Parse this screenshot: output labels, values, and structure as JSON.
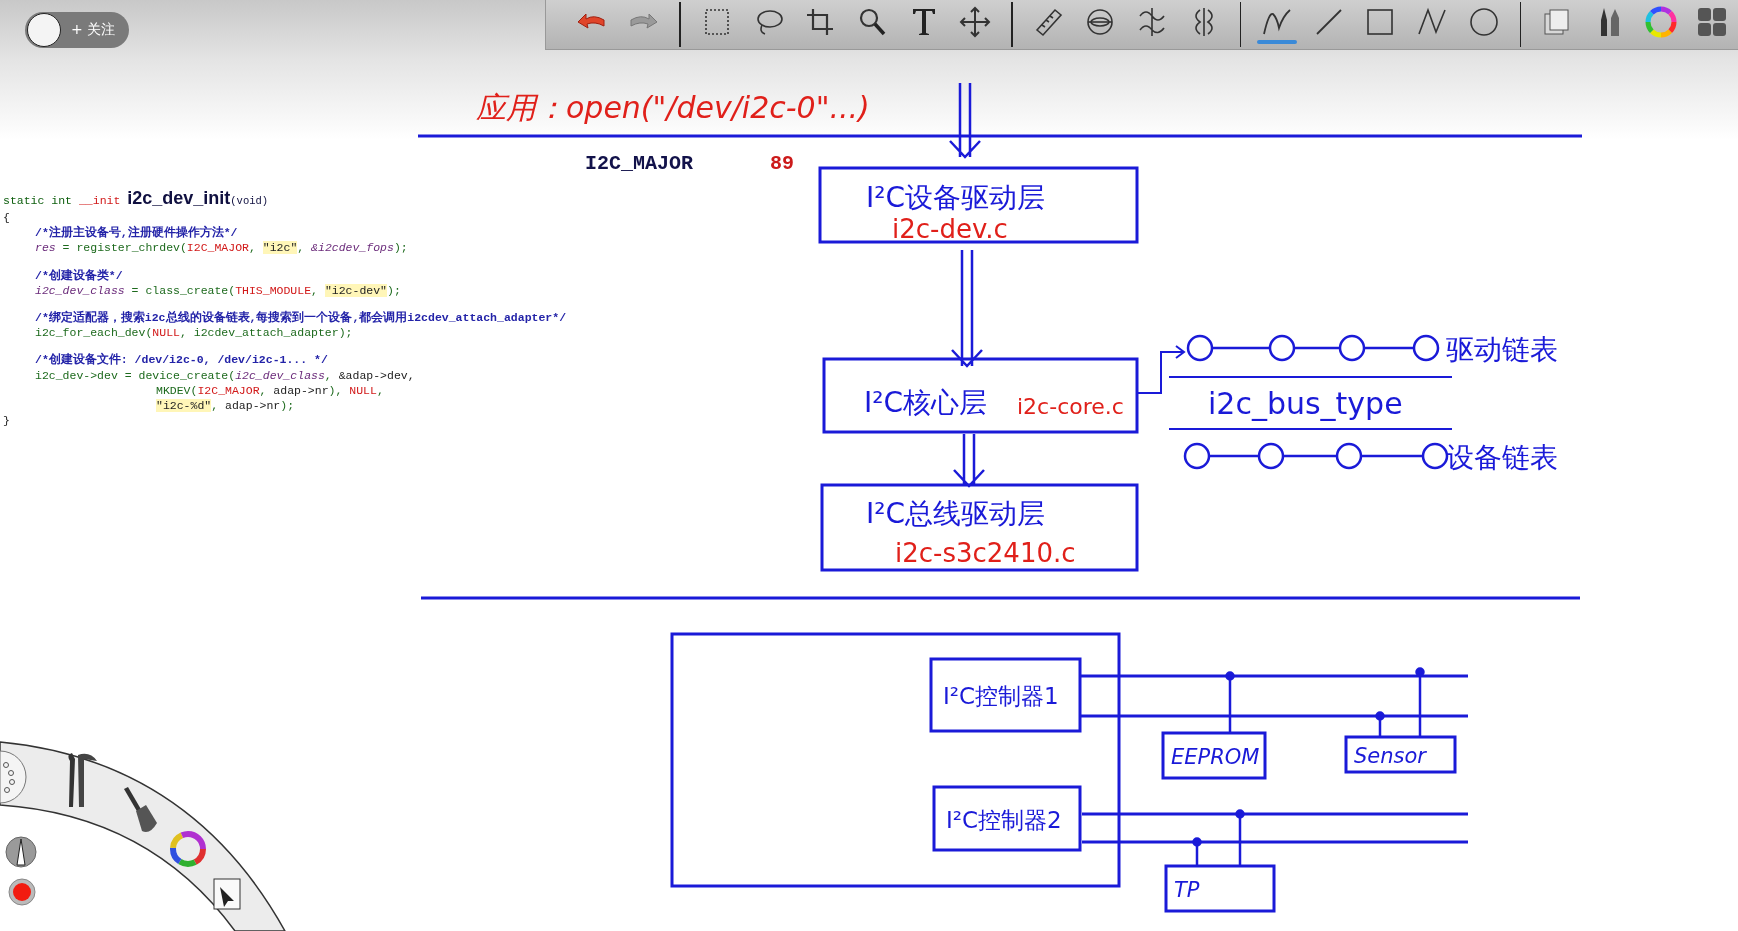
{
  "follow_button": {
    "label": "+ 关注"
  },
  "toolbar": {
    "groups": [
      {
        "tools": [
          {
            "kind": "undo",
            "selected": false
          },
          {
            "kind": "redo",
            "selected": false
          }
        ]
      },
      {
        "tools": [
          {
            "kind": "select",
            "selected": false
          },
          {
            "kind": "lasso",
            "selected": false
          },
          {
            "kind": "crop",
            "selected": false
          },
          {
            "kind": "zoom",
            "selected": false
          },
          {
            "kind": "text",
            "selected": false
          },
          {
            "kind": "move",
            "selected": false
          }
        ]
      },
      {
        "tools": [
          {
            "kind": "ruler",
            "selected": false
          },
          {
            "kind": "ellipse-guide",
            "selected": false
          },
          {
            "kind": "symmetry",
            "selected": false
          },
          {
            "kind": "radial-symmetry",
            "selected": false
          }
        ]
      },
      {
        "tools": [
          {
            "kind": "curve",
            "selected": true
          },
          {
            "kind": "line",
            "selected": false
          },
          {
            "kind": "rectangle",
            "selected": false
          },
          {
            "kind": "polyline",
            "selected": false
          },
          {
            "kind": "circle",
            "selected": false
          }
        ]
      },
      {
        "tools": [
          {
            "kind": "layers",
            "selected": false
          },
          {
            "kind": "brushes",
            "selected": false
          },
          {
            "kind": "color-wheel",
            "selected": false
          },
          {
            "kind": "grid",
            "selected": false
          }
        ]
      }
    ]
  },
  "code": {
    "lines": [
      {
        "kind": "head",
        "tokens": [
          {
            "kind": "keyword",
            "text": "static int "
          },
          {
            "kind": "macro",
            "text": "__init "
          },
          {
            "kind": "title",
            "text": "i2c_dev_init"
          },
          {
            "kind": "small",
            "text": "(void)"
          }
        ]
      },
      {
        "kind": "brace",
        "tokens": [
          {
            "kind": "dark",
            "text": "{"
          }
        ]
      },
      {
        "kind": "body",
        "tokens": [
          {
            "kind": "comment",
            "text": "/*注册主设备号,注册硬件操作方法*/"
          }
        ]
      },
      {
        "kind": "body",
        "tokens": [
          {
            "kind": "var",
            "text": "res"
          },
          {
            "kind": "plain",
            "text": " = register_chrdev("
          },
          {
            "kind": "macro",
            "text": "I2C_MAJOR"
          },
          {
            "kind": "plain",
            "text": ", "
          },
          {
            "kind": "string",
            "text": "\"i2c\""
          },
          {
            "kind": "plain",
            "text": ", "
          },
          {
            "kind": "var",
            "text": "&i2cdev_fops"
          },
          {
            "kind": "plain",
            "text": ");"
          }
        ]
      },
      {
        "kind": "body-gap",
        "tokens": [
          {
            "kind": "comment",
            "text": "/*创建设备类*/"
          }
        ]
      },
      {
        "kind": "body",
        "tokens": [
          {
            "kind": "var",
            "text": "i2c_dev_class"
          },
          {
            "kind": "plain",
            "text": " = class_create("
          },
          {
            "kind": "macro",
            "text": "THIS_MODULE"
          },
          {
            "kind": "plain",
            "text": ", "
          },
          {
            "kind": "string",
            "text": "\"i2c-dev\""
          },
          {
            "kind": "plain",
            "text": ");"
          }
        ]
      },
      {
        "kind": "body-gap",
        "tokens": [
          {
            "kind": "comment",
            "text": "/*绑定适配器，搜索i2c总线的设备链表,每搜索到一个设备,都会调用i2cdev_attach_adapter*/"
          }
        ]
      },
      {
        "kind": "body",
        "tokens": [
          {
            "kind": "plain",
            "text": "i2c_for_each_dev("
          },
          {
            "kind": "macro",
            "text": "NULL"
          },
          {
            "kind": "plain",
            "text": ", i2cdev_attach_adapter);"
          }
        ]
      },
      {
        "kind": "body-gap",
        "tokens": [
          {
            "kind": "comment",
            "text": "/*创建设备文件: /dev/i2c-0, /dev/i2c-1... */"
          }
        ]
      },
      {
        "kind": "body",
        "tokens": [
          {
            "kind": "plain",
            "text": "i2c_dev->dev = device_create("
          },
          {
            "kind": "var",
            "text": "i2c_dev_class"
          },
          {
            "kind": "plain",
            "text": ", "
          },
          {
            "kind": "dark",
            "text": "&adap->dev,"
          }
        ]
      },
      {
        "kind": "cont",
        "tokens": [
          {
            "kind": "plain",
            "text": "MKDEV("
          },
          {
            "kind": "macro",
            "text": "I2C_MAJOR"
          },
          {
            "kind": "plain",
            "text": ", "
          },
          {
            "kind": "dark",
            "text": "adap->nr"
          },
          {
            "kind": "plain",
            "text": "), "
          },
          {
            "kind": "macro",
            "text": "NULL"
          },
          {
            "kind": "plain",
            "text": ","
          }
        ]
      },
      {
        "kind": "cont",
        "tokens": [
          {
            "kind": "string",
            "text": "\"i2c-%d\""
          },
          {
            "kind": "plain",
            "text": ", "
          },
          {
            "kind": "dark",
            "text": "adap->nr"
          },
          {
            "kind": "plain",
            "text": ");"
          }
        ]
      },
      {
        "kind": "brace",
        "tokens": [
          {
            "kind": "dark",
            "text": "}"
          }
        ]
      }
    ]
  },
  "diagram": {
    "app_call": "应用：open(\"/dev/i2c-0\"...)",
    "major": {
      "name": "I2C_MAJOR",
      "value": "89"
    },
    "layers": [
      {
        "title": "I²C设备驱动层",
        "file": "i2c-dev.c"
      },
      {
        "title": "I²C核心层",
        "file": "i2c-core.c"
      },
      {
        "title": "I²C总线驱动层",
        "file": "i2c-s3c2410.c"
      }
    ],
    "lists": [
      {
        "label": "驱动链表"
      },
      {
        "label": "设备链表"
      }
    ],
    "bus_type": "i2c_bus_type",
    "controllers": [
      {
        "label": "I²C控制器1"
      },
      {
        "label": "I²C控制器2"
      }
    ],
    "devices": [
      {
        "label": "EEPROM"
      },
      {
        "label": "Sensor"
      },
      {
        "label": "TP"
      }
    ]
  }
}
